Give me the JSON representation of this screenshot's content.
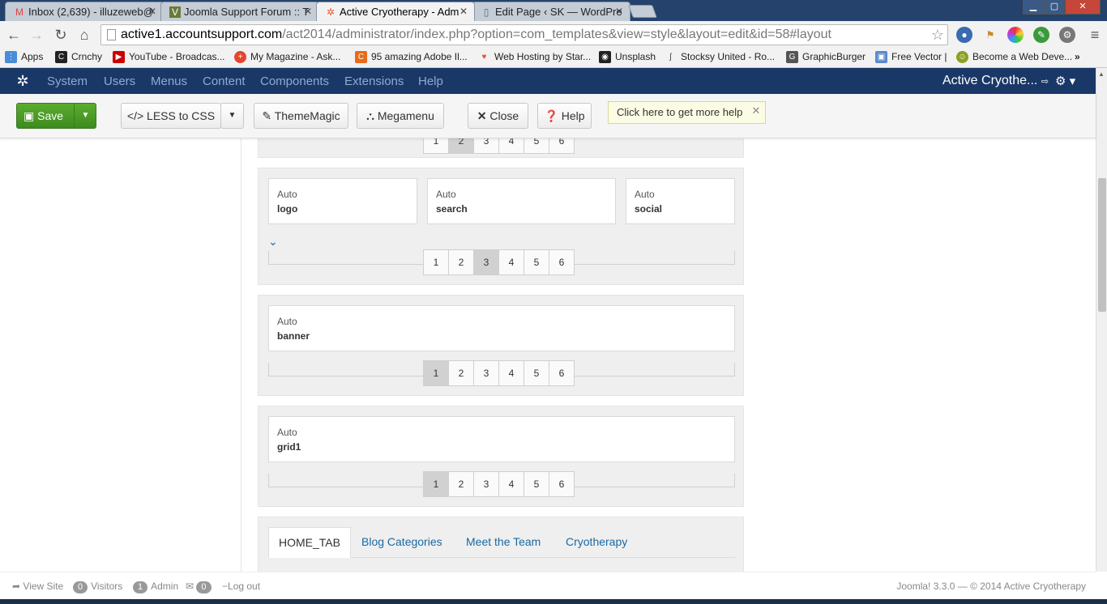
{
  "browser": {
    "tabs": [
      {
        "title": "Inbox (2,639) - illuzeweb@",
        "icon": "gmail-icon"
      },
      {
        "title": "Joomla Support Forum :: T",
        "icon": "forum-icon"
      },
      {
        "title": "Active Cryotherapy - Adm",
        "icon": "joomla-icon"
      },
      {
        "title": "Edit Page ‹ SK — WordPre",
        "icon": "page-icon"
      }
    ],
    "close_glyph": "✕",
    "url_host": "active1.accountsupport.com",
    "url_path": "/act2014/administrator/index.php?option=com_templates&view=style&layout=edit&id=58#layout",
    "bookmarks": [
      {
        "label": "Apps",
        "color": "#4a8cd8"
      },
      {
        "label": "Crnchy",
        "color": "#222222"
      },
      {
        "label": "YouTube - Broadcas...",
        "color": "#cc0000"
      },
      {
        "label": "My Magazine - Ask...",
        "color": "#e8442c"
      },
      {
        "label": "95 amazing Adobe Il...",
        "color": "#e86a1c"
      },
      {
        "label": "Web Hosting by Star...",
        "color": "#e8542c"
      },
      {
        "label": "Unsplash",
        "color": "#222222"
      },
      {
        "label": "Stocksy United - Ro...",
        "color": "#444444"
      },
      {
        "label": "GraphicBurger",
        "color": "#555555"
      },
      {
        "label": "Free Vector |",
        "color": "#5a8ad0"
      },
      {
        "label": "Become a Web Deve...",
        "color": "#8aa020"
      }
    ],
    "more_bookmarks": "»"
  },
  "joomla": {
    "menu": [
      "System",
      "Users",
      "Menus",
      "Content",
      "Components",
      "Extensions",
      "Help"
    ],
    "site_name": "Active Cryothe...",
    "toolbar": {
      "save": "Save",
      "less_to_css": "LESS to CSS",
      "thememagic": "ThemeMagic",
      "megamenu": "Megamenu",
      "close": "Close",
      "help": "Help",
      "help_tip": "Click here to get more help"
    },
    "accent_color": "#46a546"
  },
  "layout": {
    "top_partial_pager": [
      "1",
      "2",
      "3",
      "4",
      "5",
      "6"
    ],
    "rows": [
      {
        "blocks": [
          {
            "size": "Auto",
            "name": "logo"
          },
          {
            "size": "Auto",
            "name": "search"
          },
          {
            "size": "Auto",
            "name": "social"
          }
        ],
        "pager": [
          "1",
          "2",
          "3",
          "4",
          "5",
          "6"
        ],
        "active": "3"
      },
      {
        "blocks": [
          {
            "size": "Auto",
            "name": "banner"
          }
        ],
        "pager": [
          "1",
          "2",
          "3",
          "4",
          "5",
          "6"
        ],
        "active": "1"
      },
      {
        "blocks": [
          {
            "size": "Auto",
            "name": "grid1"
          }
        ],
        "pager": [
          "1",
          "2",
          "3",
          "4",
          "5",
          "6"
        ],
        "active": "1"
      }
    ],
    "tabs": [
      "HOME_TAB",
      "Blog Categories",
      "Meet the Team",
      "Cryotherapy"
    ]
  },
  "status": {
    "view_site": "View Site",
    "visitors_count": "0",
    "visitors_label": "Visitors",
    "admin_count": "1",
    "admin_label": "Admin",
    "messages_count": "0",
    "logout": "Log out",
    "version": "Joomla! 3.3.0  —  © 2014 Active Cryotherapy"
  }
}
